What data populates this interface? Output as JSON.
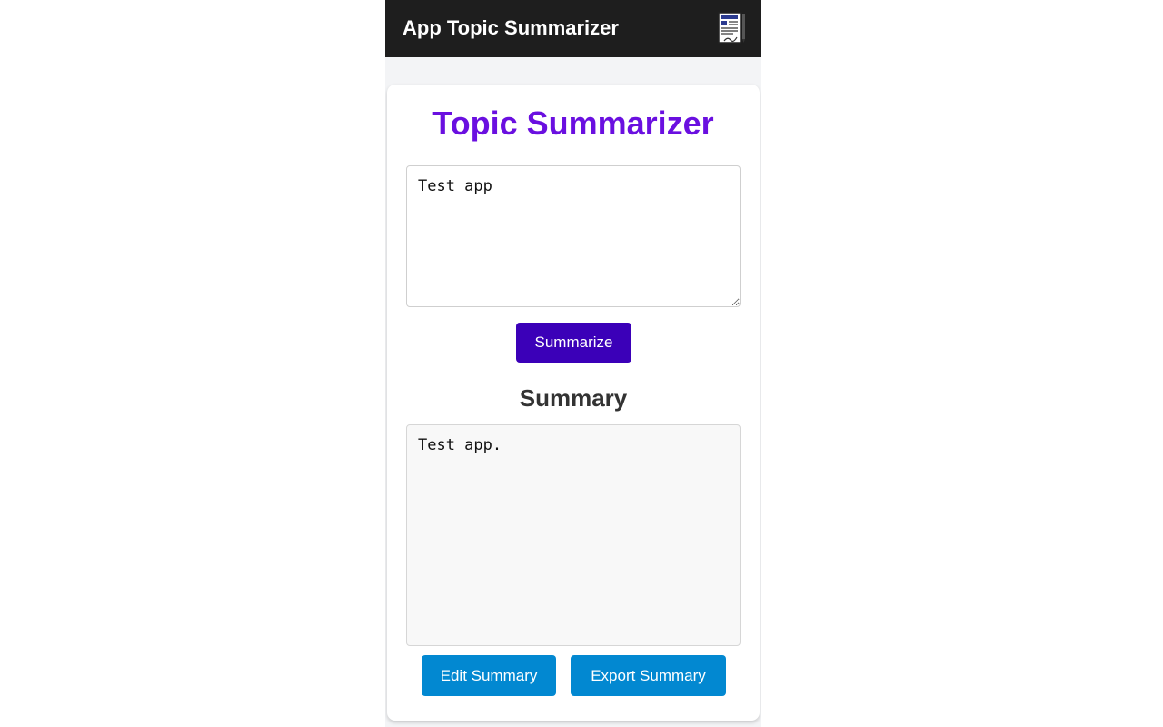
{
  "app_bar": {
    "title": "App Topic Summarizer",
    "icon": "document-edit-icon",
    "background": "#1e1e1e"
  },
  "card": {
    "title": "Topic Summarizer",
    "title_color": "#6a0fe0",
    "topic_input": {
      "value": "Test app"
    },
    "summarize_button": {
      "label": "Summarize",
      "color": "#3b00b8"
    },
    "summary_heading": "Summary",
    "summary_output": {
      "value": "Test app."
    },
    "edit_button": {
      "label": "Edit Summary",
      "color": "#0288d1"
    },
    "export_button": {
      "label": "Export Summary",
      "color": "#0288d1"
    }
  }
}
